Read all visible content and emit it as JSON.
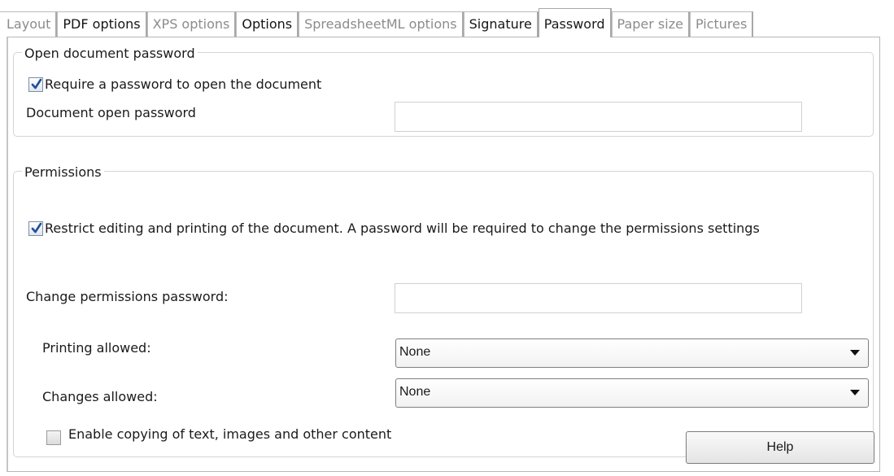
{
  "tabs": [
    {
      "label": "Layout",
      "state": "disabled"
    },
    {
      "label": "PDF options",
      "state": "enabled"
    },
    {
      "label": "XPS options",
      "state": "disabled"
    },
    {
      "label": "Options",
      "state": "enabled"
    },
    {
      "label": "SpreadsheetML options",
      "state": "disabled"
    },
    {
      "label": "Signature",
      "state": "enabled"
    },
    {
      "label": "Password",
      "state": "active"
    },
    {
      "label": "Paper size",
      "state": "disabled"
    },
    {
      "label": "Pictures",
      "state": "disabled"
    }
  ],
  "open_password": {
    "legend": "Open document password",
    "require_checkbox": {
      "label": "Require a password to open the document",
      "checked": true
    },
    "password_label": "Document open password",
    "password_value": ""
  },
  "permissions": {
    "legend": "Permissions",
    "restrict_checkbox": {
      "label": "Restrict editing and printing of the document. A password will be required to change the permissions settings",
      "checked": true
    },
    "change_password_label": "Change permissions password:",
    "change_password_value": "",
    "printing_label": "Printing allowed:",
    "printing_value": "None",
    "changes_label": "Changes allowed:",
    "changes_value": "None",
    "copy_checkbox": {
      "label": "Enable copying of text, images and other content",
      "checked": false
    }
  },
  "help_button": "Help",
  "colors": {
    "check_mark": "#1f4f9a",
    "disabled_text": "#8c8c8c"
  }
}
